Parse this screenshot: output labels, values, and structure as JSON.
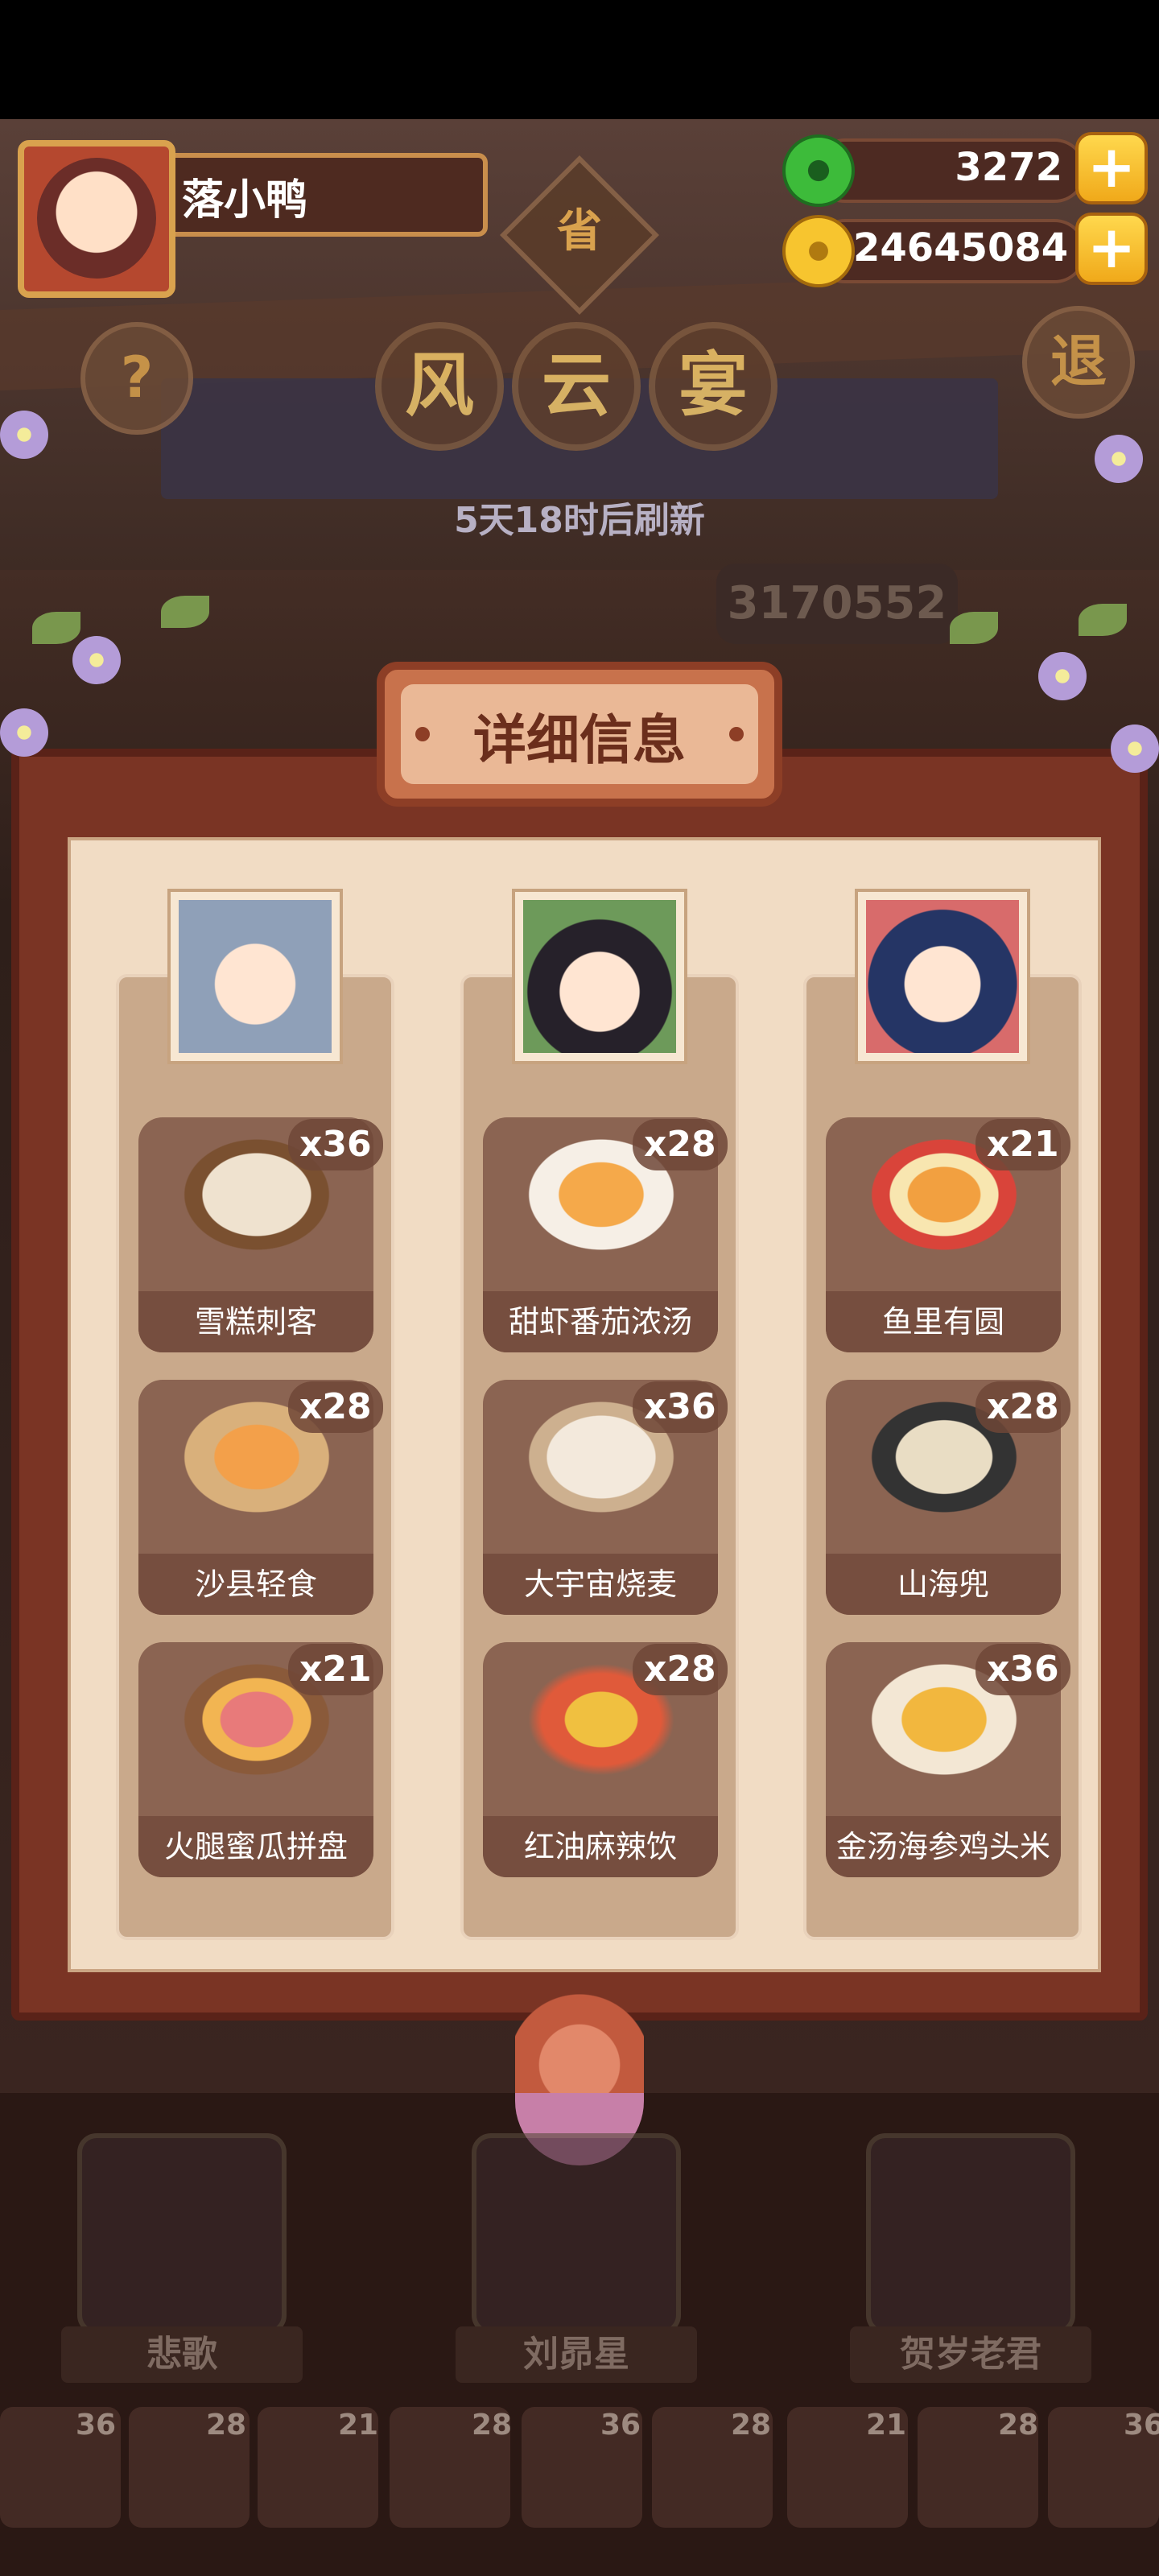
{
  "player": {
    "name": "落小鸭"
  },
  "currency": {
    "jade": "3272",
    "coins": "24645084",
    "plus": "+"
  },
  "header": {
    "help_icon_text": "?",
    "province_char": "省",
    "title_chars": [
      "风",
      "云",
      "宴"
    ],
    "exit_char": "退",
    "refresh_text": "5天18时后刷新",
    "score": "3170552"
  },
  "panel": {
    "title": "详细信息",
    "columns": [
      {
        "character": "悲歌",
        "dishes": [
          {
            "name": "雪糕刺客",
            "count": "x36"
          },
          {
            "name": "沙县轻食",
            "count": "x28"
          },
          {
            "name": "火腿蜜瓜拼盘",
            "count": "x21"
          }
        ]
      },
      {
        "character": "刘昴星",
        "dishes": [
          {
            "name": "甜虾番茄浓汤",
            "count": "x28"
          },
          {
            "name": "大宇宙烧麦",
            "count": "x36"
          },
          {
            "name": "红油麻辣饮",
            "count": "x28"
          }
        ]
      },
      {
        "character": "贺岁老君",
        "dishes": [
          {
            "name": "鱼里有圆",
            "count": "x21"
          },
          {
            "name": "山海兜",
            "count": "x28"
          },
          {
            "name": "金汤海参鸡头米",
            "count": "x36"
          }
        ]
      }
    ]
  },
  "bottom": {
    "characters": [
      "悲歌",
      "刘昴星",
      "贺岁老君"
    ],
    "dish_counts": [
      "36",
      "28",
      "21",
      "28",
      "36",
      "28",
      "21",
      "28",
      "36"
    ]
  },
  "colors": {
    "panel_bg": "#f1dcc4",
    "frame": "#7a3424",
    "card": "#8b6452",
    "gold": "#f0a91a"
  }
}
